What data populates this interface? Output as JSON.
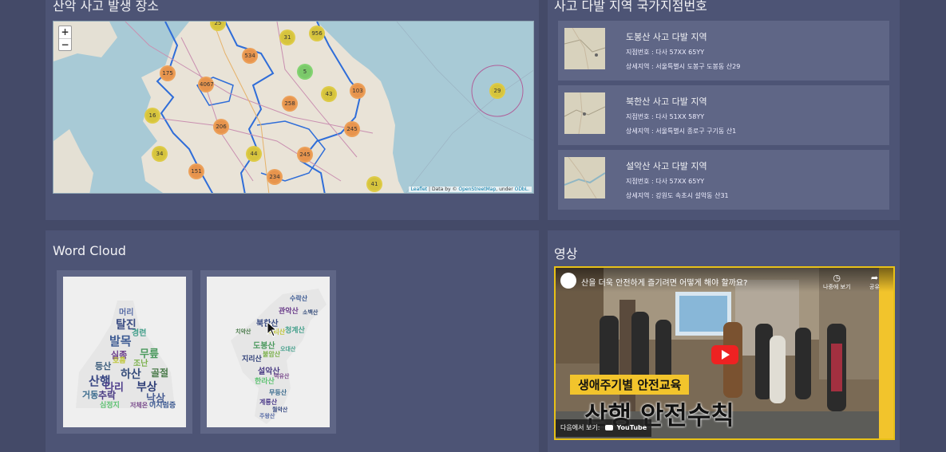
{
  "map_panel": {
    "title": "산악 사고 발생 장소",
    "zoom_in": "+",
    "zoom_out": "−",
    "attribution": [
      "Leaflet",
      " | Data by © ",
      "OpenStreetMap",
      ", under ",
      "ODbL."
    ],
    "clusters": [
      "25",
      "31",
      "956",
      "534",
      "175",
      "4067",
      "5",
      "103",
      "43",
      "16",
      "258",
      "206",
      "245",
      "34",
      "44",
      "245",
      "151",
      "234",
      "41",
      "29"
    ]
  },
  "sites_panel": {
    "title": "사고 다발 지역 국가지점번호",
    "sites": [
      {
        "name": "도봉산 사고 다발 지역",
        "code": "지점번호 : 다사 57XX 65YY",
        "detail": "상세지역 : 서울특별시 도봉구 도봉동 산29"
      },
      {
        "name": "북한산 사고 다발 지역",
        "code": "지점번호 : 다사 51XX 58YY",
        "detail": "상세지역 : 서울특별시 종로구 구기동 산1"
      },
      {
        "name": "설악산 사고 다발 지역",
        "code": "지점번호 : 다사 57XX 65YY",
        "detail": "상세지역 : 강원도 속초시 설악동 산31"
      }
    ]
  },
  "wordcloud_panel": {
    "title": "Word Cloud",
    "cloud1": [
      "머리",
      "탈진",
      "경련",
      "발목",
      "골절",
      "산행",
      "추락",
      "실족",
      "하산",
      "부상",
      "다리",
      "거동",
      "조난",
      "등산",
      "무릎",
      "심정지",
      "낙상",
      "호흡",
      "저체온",
      "어지럼증"
    ],
    "cloud2": [
      "북한산",
      "도봉산",
      "관악산",
      "청계산",
      "수락산",
      "불암산",
      "설악산",
      "지리산",
      "한라산",
      "무등산",
      "계룡산",
      "속리산",
      "치악산",
      "소백산",
      "월악산",
      "덕유산",
      "오대산",
      "주왕산"
    ]
  },
  "video_panel": {
    "title": "영상",
    "video_title": "산을 더욱 안전하게 즐기려면 어떻게 해야 할까요?",
    "watch_later": "나중에 보기",
    "share": "공유",
    "banner_top": "생애주기별 안전교육",
    "banner_main": "산행 안전수칙",
    "watch_on": "다음에서 보기:",
    "youtube": "YouTube"
  }
}
